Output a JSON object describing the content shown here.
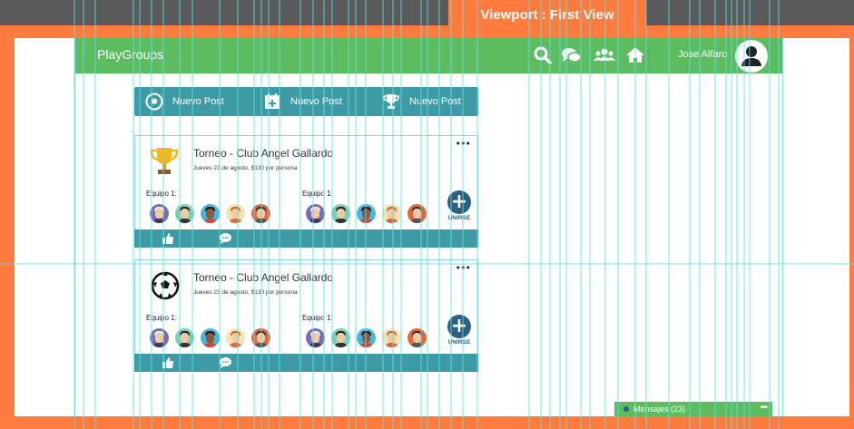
{
  "viewport_label": "Viewport : First View",
  "colors": {
    "orange": "#ff7a3d",
    "green": "#5cbc5f",
    "teal": "#3e9aa5",
    "navy": "#2e5f7e",
    "guide": "#5ce0e6"
  },
  "topbar": {
    "brand": "PlayGroups",
    "icons": [
      "search-icon",
      "chat-icon",
      "group-icon",
      "home-icon"
    ],
    "user_name": "Jose Alfaro"
  },
  "new_post_bar": {
    "items": [
      {
        "icon": "soccer-ball-icon",
        "label": "Nuevo Post"
      },
      {
        "icon": "calendar-plus-icon",
        "label": "Nuevo Post"
      },
      {
        "icon": "trophy-icon",
        "label": "Nuevo Post"
      }
    ]
  },
  "posts": [
    {
      "icon": "trophy-icon",
      "title": "Torneo - Club Angel Gallardo",
      "subtitle": "Jueves 23 de agosto, $130 por persona",
      "team1_label": "Equipo 1:",
      "team2_label": "Equipo 1:",
      "join_label": "UNIRSE"
    },
    {
      "icon": "soccer-ball-icon",
      "title": "Torneo - Club Angel Gallardo",
      "subtitle": "Jueves 23 de agosto, $130 por persona",
      "team1_label": "Equipo 1:",
      "team2_label": "Equipo 1:",
      "join_label": "UNIRSE"
    }
  ],
  "messages": {
    "label": "Mensajes (23)"
  }
}
